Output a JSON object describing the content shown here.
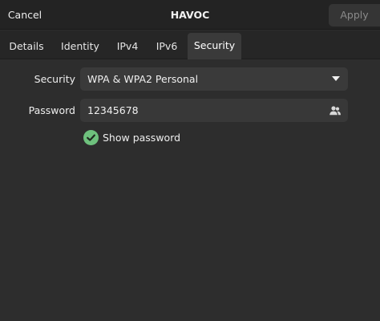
{
  "header": {
    "cancel_label": "Cancel",
    "title": "HAVOC",
    "apply_label": "Apply"
  },
  "tabs": [
    {
      "label": "Details",
      "active": false
    },
    {
      "label": "Identity",
      "active": false
    },
    {
      "label": "IPv4",
      "active": false
    },
    {
      "label": "IPv6",
      "active": false
    },
    {
      "label": "Security",
      "active": true
    }
  ],
  "security": {
    "security_label": "Security",
    "security_value": "WPA & WPA2 Personal",
    "password_label": "Password",
    "password_value": "12345678",
    "show_password_label": "Show password",
    "show_password_checked": true
  },
  "icons": {
    "dropdown": "chevron-down-icon",
    "password_user": "users-icon",
    "checkbox": "check-icon"
  },
  "colors": {
    "background": "#2d2d2d",
    "headerbar": "#232323",
    "tabbar": "#262626",
    "active_tab": "#3a3a3a",
    "field": "#3a3a3a",
    "checkbox": "#6ec17d",
    "disabled_text": "#8a8a8a"
  }
}
